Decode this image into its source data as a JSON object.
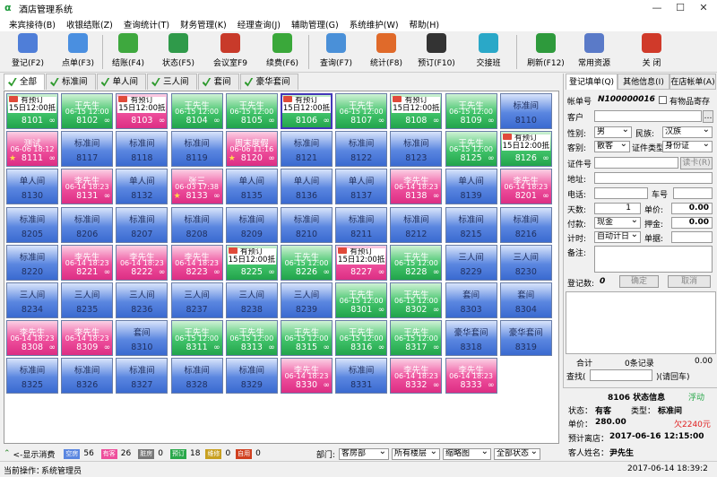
{
  "window": {
    "title": "酒店管理系统",
    "minimize": "—",
    "maximize": "☐",
    "close": "✕"
  },
  "menu": [
    "来宾接待(B)",
    "收银结账(Z)",
    "查询统计(T)",
    "财务管理(K)",
    "经理查询(J)",
    "辅助管理(G)",
    "系统维护(W)",
    "帮助(H)"
  ],
  "toolbar": [
    {
      "label": "登记(F2)",
      "icon": "register-icon",
      "color": "#4f7ed8"
    },
    {
      "label": "点单(F3)",
      "icon": "order-icon",
      "color": "#4a8fe0"
    },
    {
      "label": "结账(F4)",
      "icon": "checkout-icon",
      "color": "#3ea83e"
    },
    {
      "label": "状态(F5)",
      "icon": "status-icon",
      "color": "#2f9a4a"
    },
    {
      "label": "会议室F9",
      "icon": "meeting-room-icon",
      "color": "#c83a2a"
    },
    {
      "label": "续费(F6)",
      "icon": "renew-icon",
      "color": "#3aa83a"
    },
    {
      "label": "查询(F7)",
      "icon": "query-icon",
      "color": "#4a90d8"
    },
    {
      "label": "统计(F8)",
      "icon": "stats-icon",
      "color": "#e06a2a"
    },
    {
      "label": "预订(F10)",
      "icon": "reserve-icon",
      "color": "#333333"
    },
    {
      "label": "交接班",
      "icon": "handover-icon",
      "color": "#2aa8c8"
    },
    {
      "label": "刷新(F12)",
      "icon": "refresh-icon",
      "color": "#2e9a3c"
    },
    {
      "label": "常用资源",
      "icon": "resources-icon",
      "color": "#5a7ac8"
    },
    {
      "label": "关 闭",
      "icon": "close-app-icon",
      "color": "#d03a2a"
    }
  ],
  "tabs": [
    "全部",
    "标准间",
    "单人间",
    "三人间",
    "套间",
    "豪华套间"
  ],
  "rooms": [
    {
      "n": "8101",
      "t": "green",
      "reserve": "有预订\n15日12:00抵"
    },
    {
      "n": "8102",
      "t": "green",
      "name": "王先生",
      "sub": "06-15 12:00"
    },
    {
      "n": "8103",
      "t": "pink",
      "reserve": "有预订\n15日12:00抵"
    },
    {
      "n": "8104",
      "t": "green",
      "name": "王先生",
      "sub": "06-15 12:00"
    },
    {
      "n": "8105",
      "t": "green",
      "name": "王先生",
      "sub": "06-15 12:00"
    },
    {
      "n": "8106",
      "t": "green",
      "reserve": "有预订\n15日12:00抵",
      "sel": true
    },
    {
      "n": "8107",
      "t": "green",
      "name": "王先生",
      "sub": "06-15 12:00"
    },
    {
      "n": "8108",
      "t": "green",
      "reserve": "有预订\n15日12:00抵"
    },
    {
      "n": "8109",
      "t": "green",
      "name": "王先生",
      "sub": "06-15 12:00"
    },
    {
      "n": "8110",
      "t": "blue",
      "name": "标准间"
    },
    {
      "n": "8111",
      "t": "pink",
      "name": "测试",
      "sub": "06-06 18:12",
      "star": true
    },
    {
      "n": "8117",
      "t": "blue",
      "name": "标准间"
    },
    {
      "n": "8118",
      "t": "blue",
      "name": "标准间"
    },
    {
      "n": "8119",
      "t": "blue",
      "name": "标准间"
    },
    {
      "n": "8120",
      "t": "pink",
      "name": "周末度假",
      "sub": "06-06 11:16",
      "star": true
    },
    {
      "n": "8121",
      "t": "blue",
      "name": "标准间"
    },
    {
      "n": "8122",
      "t": "blue",
      "name": "标准间"
    },
    {
      "n": "8123",
      "t": "blue",
      "name": "标准间"
    },
    {
      "n": "8125",
      "t": "green",
      "name": "王先生",
      "sub": "06-15 12:00"
    },
    {
      "n": "8126",
      "t": "green",
      "reserve": "有预订\n15日12:00抵"
    },
    {
      "n": "8130",
      "t": "blue",
      "name": "单人间"
    },
    {
      "n": "8131",
      "t": "pink",
      "name": "李先生",
      "sub": "06-14 18:23"
    },
    {
      "n": "8132",
      "t": "blue",
      "name": "单人间"
    },
    {
      "n": "8133",
      "t": "pink",
      "name": "张三",
      "sub": "06-03 17:38",
      "star": true
    },
    {
      "n": "8135",
      "t": "blue",
      "name": "单人间"
    },
    {
      "n": "8136",
      "t": "blue",
      "name": "单人间"
    },
    {
      "n": "8137",
      "t": "blue",
      "name": "单人间"
    },
    {
      "n": "8138",
      "t": "pink",
      "name": "李先生",
      "sub": "06-14 18:23"
    },
    {
      "n": "8139",
      "t": "blue",
      "name": "单人间"
    },
    {
      "n": "8201",
      "t": "pink",
      "name": "李先生",
      "sub": "06-14 18:23"
    },
    {
      "n": "8205",
      "t": "blue",
      "name": "标准间"
    },
    {
      "n": "8206",
      "t": "blue",
      "name": "标准间"
    },
    {
      "n": "8207",
      "t": "blue",
      "name": "标准间"
    },
    {
      "n": "8208",
      "t": "blue",
      "name": "标准间"
    },
    {
      "n": "8209",
      "t": "blue",
      "name": "标准间"
    },
    {
      "n": "8210",
      "t": "blue",
      "name": "标准间"
    },
    {
      "n": "8211",
      "t": "blue",
      "name": "标准间"
    },
    {
      "n": "8212",
      "t": "blue",
      "name": "标准间"
    },
    {
      "n": "8215",
      "t": "blue",
      "name": "标准间"
    },
    {
      "n": "8216",
      "t": "blue",
      "name": "标准间"
    },
    {
      "n": "8220",
      "t": "blue",
      "name": "标准间"
    },
    {
      "n": "8221",
      "t": "pink",
      "name": "李先生",
      "sub": "06-14 18:23"
    },
    {
      "n": "8222",
      "t": "pink",
      "name": "李先生",
      "sub": "06-14 18:23"
    },
    {
      "n": "8223",
      "t": "pink",
      "name": "李先生",
      "sub": "06-14 18:23"
    },
    {
      "n": "8225",
      "t": "green",
      "reserve": "有预订\n15日12:00抵"
    },
    {
      "n": "8226",
      "t": "green",
      "name": "王先生",
      "sub": "06-15 12:00"
    },
    {
      "n": "8227",
      "t": "pink",
      "reserve": "有预订\n15日12:00抵"
    },
    {
      "n": "8228",
      "t": "green",
      "name": "王先生",
      "sub": "06-15 12:00"
    },
    {
      "n": "8229",
      "t": "blue",
      "name": "三人间"
    },
    {
      "n": "8230",
      "t": "blue",
      "name": "三人间"
    },
    {
      "n": "8234",
      "t": "blue",
      "name": "三人间"
    },
    {
      "n": "8235",
      "t": "blue",
      "name": "三人间"
    },
    {
      "n": "8236",
      "t": "blue",
      "name": "三人间"
    },
    {
      "n": "8237",
      "t": "blue",
      "name": "三人间"
    },
    {
      "n": "8238",
      "t": "blue",
      "name": "三人间"
    },
    {
      "n": "8239",
      "t": "blue",
      "name": "三人间"
    },
    {
      "n": "8301",
      "t": "green",
      "name": "王先生",
      "sub": "06-15 12:00"
    },
    {
      "n": "8302",
      "t": "green",
      "name": "王先生",
      "sub": "06-15 12:00"
    },
    {
      "n": "8303",
      "t": "blue",
      "name": "套间"
    },
    {
      "n": "8304",
      "t": "blue",
      "name": "套间"
    },
    {
      "n": "8308",
      "t": "pink",
      "name": "李先生",
      "sub": "06-14 18:23"
    },
    {
      "n": "8309",
      "t": "pink",
      "name": "李先生",
      "sub": "06-14 18:23"
    },
    {
      "n": "8310",
      "t": "blue",
      "name": "套间"
    },
    {
      "n": "8311",
      "t": "green",
      "name": "王先生",
      "sub": "06-15 12:00"
    },
    {
      "n": "8313",
      "t": "green",
      "name": "王先生",
      "sub": "06-15 12:00"
    },
    {
      "n": "8315",
      "t": "green",
      "name": "王先生",
      "sub": "06-15 12:00"
    },
    {
      "n": "8316",
      "t": "green",
      "name": "王先生",
      "sub": "06-15 12:00"
    },
    {
      "n": "8317",
      "t": "green",
      "name": "王先生",
      "sub": "06-15 12:00"
    },
    {
      "n": "8318",
      "t": "blue",
      "name": "豪华套间"
    },
    {
      "n": "8319",
      "t": "blue",
      "name": "豪华套间"
    },
    {
      "n": "8325",
      "t": "blue",
      "name": "标准间"
    },
    {
      "n": "8326",
      "t": "blue",
      "name": "标准间"
    },
    {
      "n": "8327",
      "t": "blue",
      "name": "标准间"
    },
    {
      "n": "8328",
      "t": "blue",
      "name": "标准间"
    },
    {
      "n": "8329",
      "t": "blue",
      "name": "标准间"
    },
    {
      "n": "8330",
      "t": "pink",
      "name": "李先生",
      "sub": "06-14 18:23"
    },
    {
      "n": "8331",
      "t": "blue",
      "name": "标准间"
    },
    {
      "n": "8332",
      "t": "pink",
      "name": "李先生",
      "sub": "06-14 18:23"
    },
    {
      "n": "8333",
      "t": "pink",
      "name": "李先生",
      "sub": "06-14 18:23"
    }
  ],
  "stats": {
    "showConsume": "<-显示消费",
    "vacant_label": "空房",
    "vacant": "56",
    "occupied_label": "有客",
    "occupied": "26",
    "dirty_label": "脏房",
    "dirty": "0",
    "reserved_label": "预订",
    "reserved": "18",
    "repair_label": "维修",
    "repair": "0",
    "selfuse_label": "自用",
    "selfuse": "0",
    "dept_label": "部门:",
    "dept": "客房部",
    "floor": "所有楼层",
    "view": "缩略图",
    "state": "全部状态"
  },
  "status": {
    "op_label": "当前操作：",
    "op": "系统管理员",
    "datetime": "2017-06-14 18:39:2"
  },
  "rp": {
    "tabs": [
      "登记填单(Q)",
      "其他信息(I)",
      "在店帐单(A)"
    ],
    "bill_label": "帐单号",
    "bill": "N100000016",
    "deposit_label": "有物品寄存",
    "customer_label": "客户",
    "gender_label": "性别:",
    "gender": "男",
    "nation_label": "民族:",
    "nation": "汉族",
    "ctype_label": "客别:",
    "ctype": "散客",
    "idtype_label": "证件类型",
    "idtype": "身份证",
    "idno_label": "证件号",
    "card_label": "读卡(R)",
    "address_label": "地址:",
    "phone_label": "电话:",
    "plate_label": "车号",
    "days_label": "天数:",
    "days": "1",
    "price_label": "单价:",
    "price": "0.00",
    "pay_label": "付款:",
    "pay": "现金",
    "deposit2_label": "押金:",
    "deposit2": "0.00",
    "timing_label": "计时:",
    "timing": "自动计日",
    "single_label": "单据:",
    "remark_label": "备注:",
    "count_label": "登记数:",
    "count": "0",
    "ok": "确定",
    "cancel": "取消",
    "total_label": "合计",
    "total": "0条记录",
    "amount": "0.00"
  },
  "info": {
    "find_label": "查找(",
    "find_hint": ")(请回车)",
    "title": "8106 状态信息",
    "float": "浮动",
    "status_label": "状态：",
    "status": "有客",
    "type_label": "类型：",
    "type": "标准间",
    "price_label": "单价：",
    "price": "280.00",
    "owe": "欠2240元",
    "arrive_label": "预计离店：",
    "arrive": "2017-06-16  12:15:00",
    "guest_label": "客人姓名：",
    "guest": "尹先生"
  }
}
